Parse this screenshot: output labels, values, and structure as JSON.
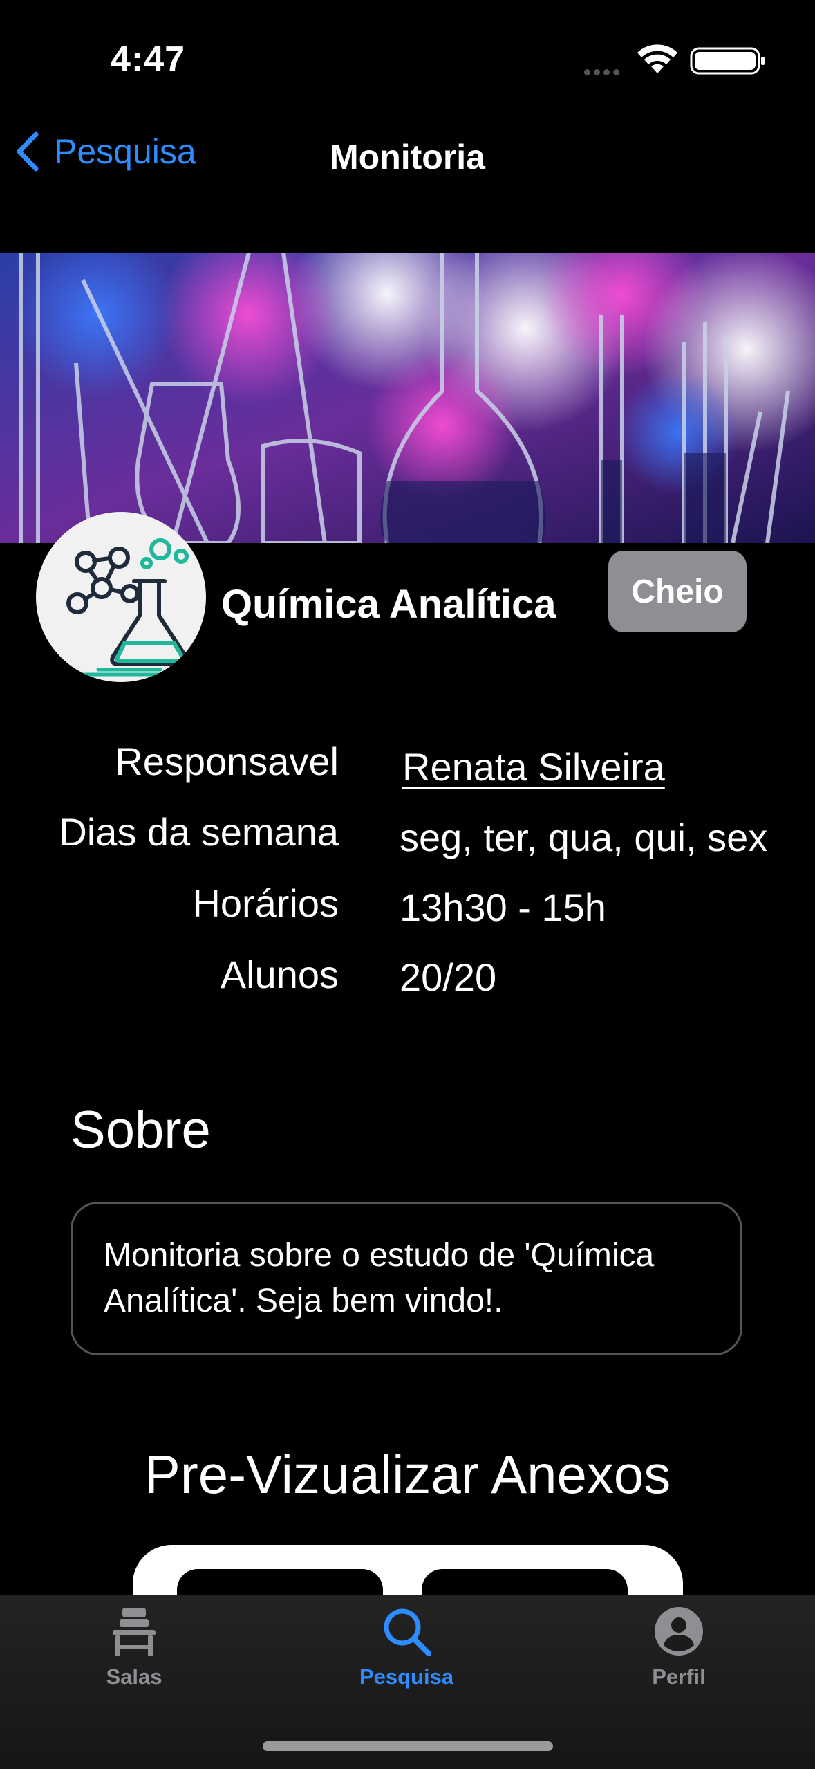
{
  "status_bar": {
    "time": "4:47"
  },
  "nav": {
    "back_label": "Pesquisa",
    "title": "Monitoria"
  },
  "header": {
    "subject": "Química Analítica",
    "status_badge": "Cheio"
  },
  "info": {
    "rows": [
      {
        "label": "Responsavel",
        "value": "Renata Silveira"
      },
      {
        "label": "Dias da semana",
        "value": "seg, ter, qua, qui, sex"
      },
      {
        "label": "Horários",
        "value": "13h30 - 15h"
      },
      {
        "label": "Alunos",
        "value": "20/20"
      }
    ]
  },
  "about": {
    "title": "Sobre",
    "text": "Monitoria sobre o estudo de 'Química Analítica'. Seja bem vindo!."
  },
  "attachments": {
    "title": "Pre-Vizualizar Anexos"
  },
  "tabbar": {
    "items": [
      {
        "label": "Salas",
        "icon": "desk-icon"
      },
      {
        "label": "Pesquisa",
        "icon": "search-icon"
      },
      {
        "label": "Perfil",
        "icon": "person-icon"
      }
    ],
    "active": "Pesquisa"
  },
  "colors": {
    "accent": "#2f8cff",
    "badge": "#8e8e93",
    "background": "#000000"
  }
}
